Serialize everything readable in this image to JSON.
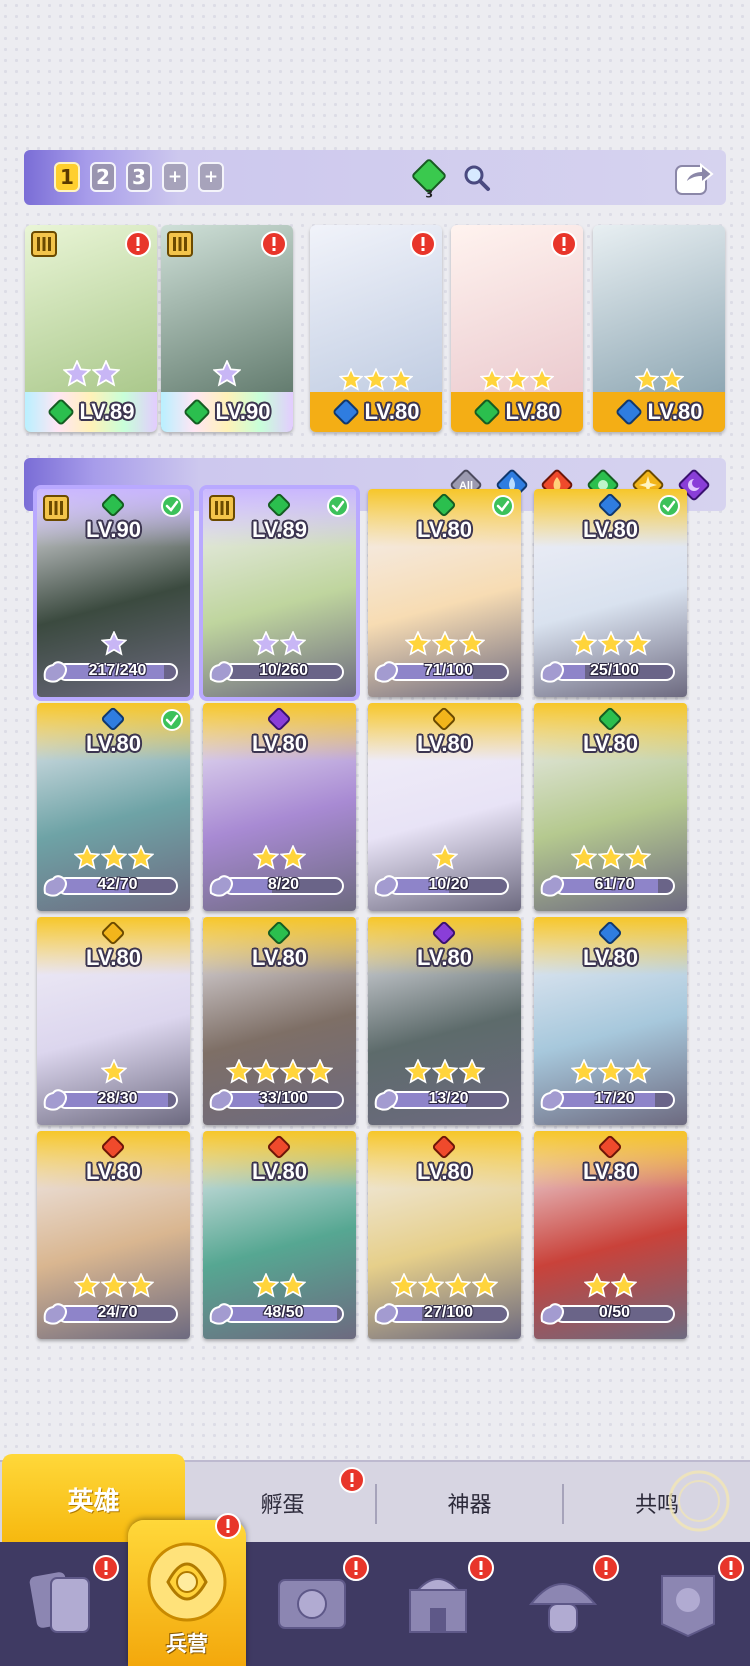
{
  "team_bar": {
    "slots": [
      "1",
      "2",
      "3",
      "+",
      "+"
    ],
    "active_slot": "1",
    "gem_count": "3"
  },
  "team": [
    {
      "level": "LV.89",
      "element": "nature",
      "stars": 2,
      "foot": "rainbow",
      "rank": true,
      "alert": true,
      "art": "#c8e0a8"
    },
    {
      "level": "LV.90",
      "element": "nature",
      "stars": 1,
      "foot": "rainbow",
      "rank": true,
      "alert": true,
      "art": "#8fa6a0"
    },
    {
      "level": "LV.80",
      "element": "water",
      "stars": 3,
      "foot": "gold",
      "rank": false,
      "alert": true,
      "art": "#c9d9ee"
    },
    {
      "level": "LV.80",
      "element": "nature",
      "stars": 3,
      "foot": "gold",
      "rank": false,
      "alert": true,
      "art": "#f5d8d8"
    },
    {
      "level": "LV.80",
      "element": "water",
      "stars": 2,
      "foot": "gold",
      "rank": false,
      "alert": false,
      "art": "#9fb6c4"
    }
  ],
  "filter": {
    "all_label": "All",
    "elements": [
      "water",
      "fire",
      "nature",
      "light",
      "dark"
    ]
  },
  "heroes": [
    {
      "level": "LV.90",
      "progress": "217/240",
      "ratio": 0.9,
      "element": "nature",
      "stars": 1,
      "rainbow": true,
      "rank": true,
      "check": true,
      "art": "#3b4a3f"
    },
    {
      "level": "LV.89",
      "progress": "10/260",
      "ratio": 0.04,
      "element": "nature",
      "stars": 2,
      "rainbow": true,
      "rank": true,
      "check": true,
      "art": "#bfd59e"
    },
    {
      "level": "LV.80",
      "progress": "71/100",
      "ratio": 0.71,
      "element": "nature",
      "stars": 3,
      "rainbow": false,
      "rank": false,
      "check": true,
      "art": "#f7dcb3"
    },
    {
      "level": "LV.80",
      "progress": "25/100",
      "ratio": 0.25,
      "element": "water",
      "stars": 3,
      "rainbow": false,
      "rank": false,
      "check": true,
      "art": "#d9e2ef"
    },
    {
      "level": "LV.80",
      "progress": "42/70",
      "ratio": 0.6,
      "element": "water",
      "stars": 3,
      "rainbow": false,
      "rank": false,
      "check": true,
      "art": "#6ea3a6"
    },
    {
      "level": "LV.80",
      "progress": "8/20",
      "ratio": 0.4,
      "element": "dark",
      "stars": 2,
      "rainbow": false,
      "rank": false,
      "check": false,
      "art": "#a88ad3"
    },
    {
      "level": "LV.80",
      "progress": "10/20",
      "ratio": 0.5,
      "element": "light",
      "stars": 1,
      "rainbow": false,
      "rank": false,
      "check": false,
      "art": "#e8e3f6"
    },
    {
      "level": "LV.80",
      "progress": "61/70",
      "ratio": 0.87,
      "element": "nature",
      "stars": 3,
      "rainbow": false,
      "rank": false,
      "check": false,
      "art": "#b5c98f"
    },
    {
      "level": "LV.80",
      "progress": "28/30",
      "ratio": 0.93,
      "element": "light",
      "stars": 1,
      "rainbow": false,
      "rank": false,
      "check": false,
      "art": "#dcd6ee"
    },
    {
      "level": "LV.80",
      "progress": "33/100",
      "ratio": 0.33,
      "element": "nature",
      "stars": 4,
      "rainbow": false,
      "rank": false,
      "check": false,
      "art": "#7e6f66"
    },
    {
      "level": "LV.80",
      "progress": "13/20",
      "ratio": 0.65,
      "element": "dark",
      "stars": 3,
      "rainbow": false,
      "rank": false,
      "check": false,
      "art": "#5d6b6b"
    },
    {
      "level": "LV.80",
      "progress": "17/20",
      "ratio": 0.85,
      "element": "water",
      "stars": 3,
      "rainbow": false,
      "rank": false,
      "check": false,
      "art": "#a7c8dc"
    },
    {
      "level": "LV.80",
      "progress": "24/70",
      "ratio": 0.34,
      "element": "fire",
      "stars": 3,
      "rainbow": false,
      "rank": false,
      "check": false,
      "art": "#d9b690"
    },
    {
      "level": "LV.80",
      "progress": "48/50",
      "ratio": 0.96,
      "element": "fire",
      "stars": 2,
      "rainbow": false,
      "rank": false,
      "check": false,
      "art": "#56a792"
    },
    {
      "level": "LV.80",
      "progress": "27/100",
      "ratio": 0.27,
      "element": "fire",
      "stars": 4,
      "rainbow": false,
      "rank": false,
      "check": false,
      "art": "#e6cf8a"
    },
    {
      "level": "LV.80",
      "progress": "0/50",
      "ratio": 0.0,
      "element": "fire",
      "stars": 2,
      "rainbow": false,
      "rank": false,
      "check": false,
      "art": "#c9423a"
    }
  ],
  "tabs": {
    "heroes": "英雄",
    "hatch": "孵蛋",
    "artifact": "神器",
    "resonance": "共鸣"
  },
  "nav": {
    "barracks": "兵营"
  },
  "colors": {
    "accent": "#f6b80e",
    "nav_bg": "#3f3a63",
    "water": "#2f7de0",
    "fire": "#ef4a2c",
    "nature": "#2bbf4e",
    "light": "#f2b51b",
    "dark": "#8a3ed8"
  }
}
